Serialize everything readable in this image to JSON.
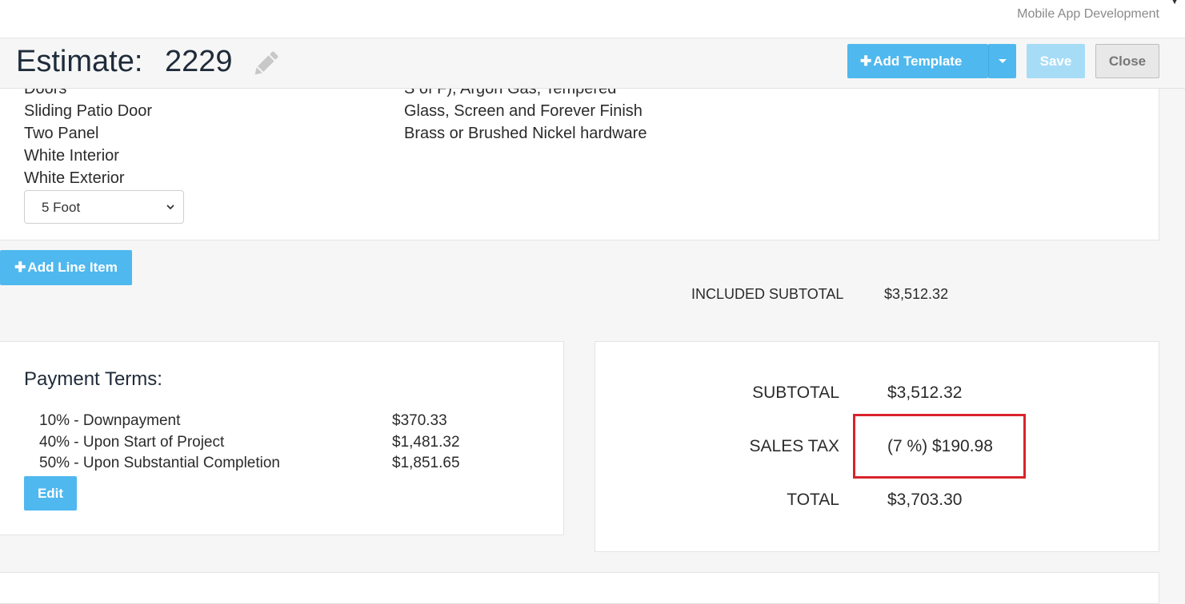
{
  "topbar": {
    "brand": "Mobile App Development"
  },
  "header": {
    "title_label": "Estimate:",
    "estimate_number": "2229",
    "add_template_label": "Add Template",
    "save_label": "Save",
    "close_label": "Close"
  },
  "line_item": {
    "left_lines": [
      "Doors",
      "Sliding Patio Door",
      "Two Panel",
      "White Interior",
      "White Exterior"
    ],
    "right_lines": [
      "S of F), Argon Gas, Tempered",
      "Glass, Screen and Forever Finish",
      "Brass or Brushed Nickel hardware"
    ],
    "size_select": "5 Foot"
  },
  "add_line_item_label": "Add Line Item",
  "included_subtotal": {
    "label": "INCLUDED SUBTOTAL",
    "value": "$3,512.32"
  },
  "payment_terms": {
    "title": "Payment Terms:",
    "rows": [
      {
        "label": "10% - Downpayment",
        "value": "$370.33"
      },
      {
        "label": "40% - Upon Start of Project",
        "value": "$1,481.32"
      },
      {
        "label": "50% - Upon Substantial Completion",
        "value": "$1,851.65"
      }
    ],
    "edit_label": "Edit"
  },
  "totals": {
    "subtotal_label": "SUBTOTAL",
    "subtotal_value": "$3,512.32",
    "sales_tax_label": "SALES TAX",
    "sales_tax_value": "(7 %) $190.98",
    "total_label": "TOTAL",
    "total_value": "$3,703.30"
  },
  "colors": {
    "accent": "#4fb8ef",
    "highlight": "#d9232d",
    "save_disabled": "#a7dcf7"
  }
}
